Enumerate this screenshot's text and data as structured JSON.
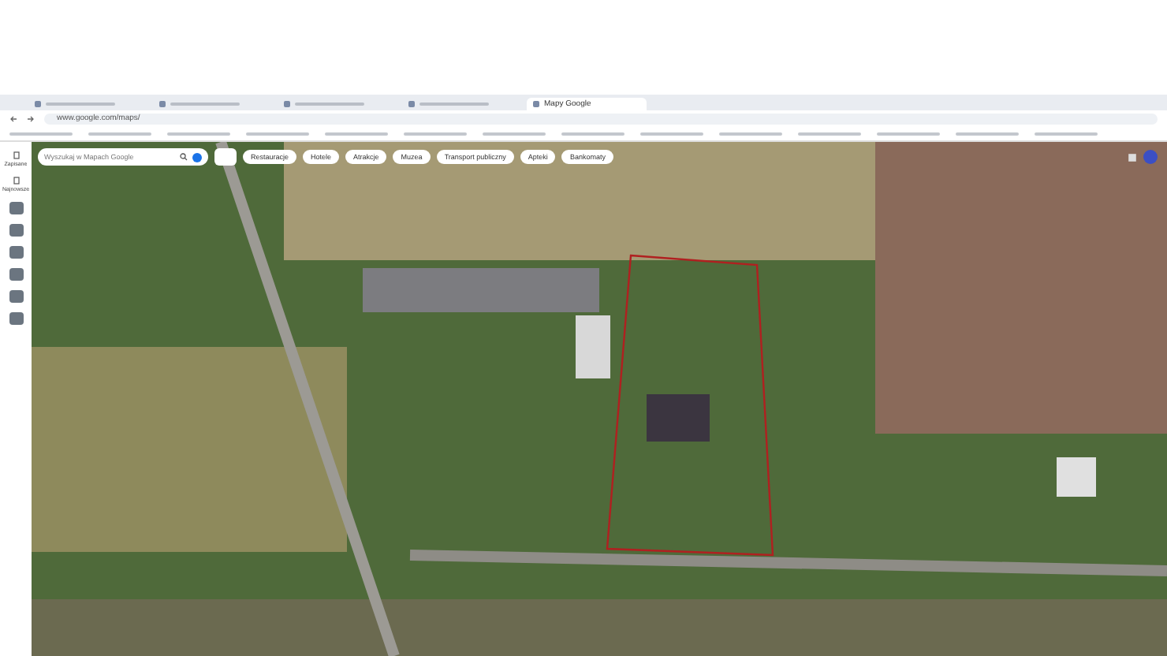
{
  "tabs": [
    {
      "selected": false
    },
    {
      "selected": false
    },
    {
      "selected": false
    },
    {
      "selected": false
    },
    {
      "label": "Mapy Google",
      "selected": true
    }
  ],
  "address": "www.google.com/maps/",
  "search": {
    "placeholder": "Wyszukaj w Mapach Google"
  },
  "chips": [
    "Restauracje",
    "Hotele",
    "Atrakcje",
    "Muzea",
    "Transport publiczny",
    "Apteki",
    "Bankomaty"
  ],
  "sidebar": [
    {
      "label": "Zapisane",
      "kind": "button"
    },
    {
      "label": "Najnowsze",
      "kind": "button"
    },
    {
      "kind": "layer"
    },
    {
      "kind": "layer"
    },
    {
      "kind": "layer"
    },
    {
      "kind": "layer"
    },
    {
      "kind": "layer"
    },
    {
      "kind": "layer"
    }
  ]
}
